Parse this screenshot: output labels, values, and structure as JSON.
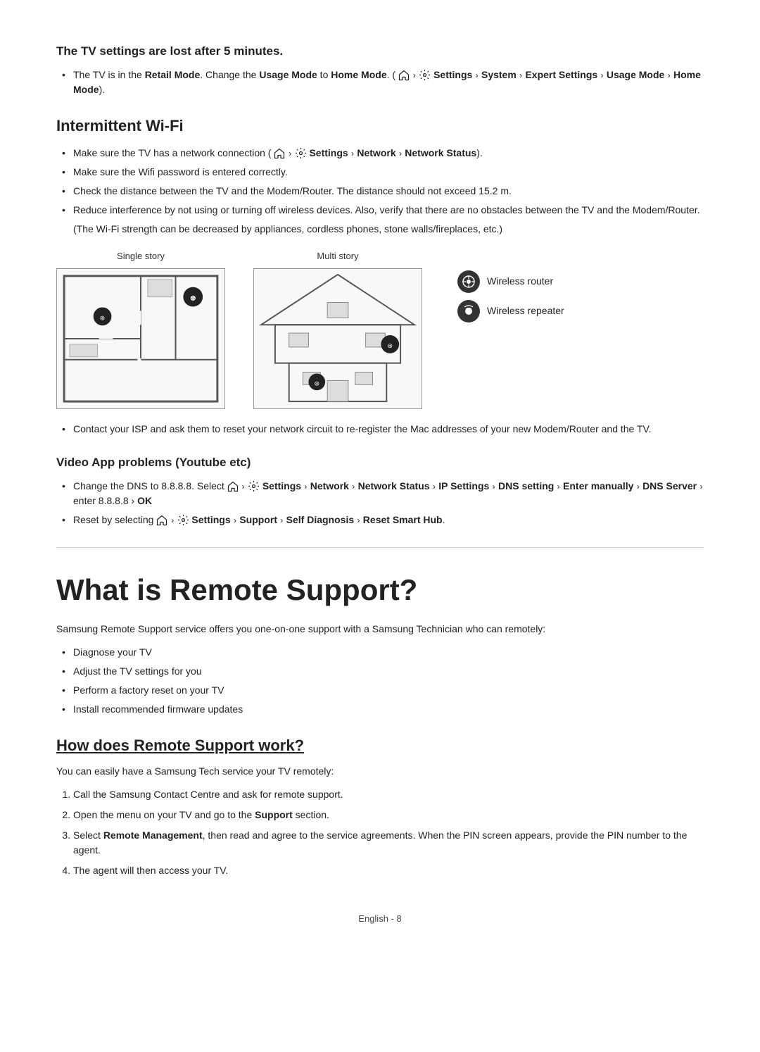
{
  "tv_settings": {
    "title": "The TV settings are lost after 5 minutes.",
    "bullet1_pre": "The TV is in the ",
    "bullet1_retail": "Retail Mode",
    "bullet1_mid": ". Change the ",
    "bullet1_usage": "Usage Mode",
    "bullet1_to": " to ",
    "bullet1_home": "Home Mode",
    "bullet1_path": ". (",
    "bullet1_settings": "Settings",
    "bullet1_system": "System",
    "bullet1_expert": "Expert Settings",
    "bullet1_usagemode": "Usage Mode",
    "bullet1_homemode": "Home Mode",
    "bullet1_end": ")."
  },
  "wifi": {
    "title": "Intermittent Wi-Fi",
    "bullet1_pre": "Make sure the TV has a network connection (",
    "bullet1_settings": "Settings",
    "bullet1_network": "Network",
    "bullet1_status": "Network Status",
    "bullet1_end": ").",
    "bullet2": "Make sure the Wifi password is entered correctly.",
    "bullet3": "Check the distance between the TV and the Modem/Router. The distance should not exceed 15.2 m.",
    "bullet4": "Reduce interference by not using or turning off wireless devices. Also, verify that there are no obstacles between the TV and the Modem/Router.",
    "note": "(The Wi-Fi strength can be decreased by appliances, cordless phones, stone walls/fireplaces, etc.)",
    "label_single": "Single story",
    "label_multi": "Multi story",
    "legend_router": "Wireless router",
    "legend_repeater": "Wireless repeater",
    "bullet5": "Contact your ISP and ask them to reset your network circuit to re-register the Mac addresses of your new Modem/Router and the TV."
  },
  "video_app": {
    "title": "Video App problems (Youtube etc)",
    "bullet1_pre": "Change the DNS to 8.8.8.8. Select ",
    "bullet1_settings": "Settings",
    "bullet1_network": "Network",
    "bullet1_status": "Network Status",
    "bullet1_ip": "IP Settings",
    "bullet1_dns": "DNS setting",
    "bullet1_enter": "Enter manually",
    "bullet1_server": "DNS Server",
    "bullet1_val": "enter 8.8.8.8",
    "bullet1_ok": "OK",
    "bullet2_pre": "Reset by selecting ",
    "bullet2_settings": "Settings",
    "bullet2_support": "Support",
    "bullet2_diag": "Self Diagnosis",
    "bullet2_reset": "Reset Smart Hub"
  },
  "remote_support": {
    "title": "What is Remote Support?",
    "intro": "Samsung Remote Support service offers you one-on-one support with a Samsung Technician who can remotely:",
    "bullets": [
      "Diagnose your TV",
      "Adjust the TV settings for you",
      "Perform a factory reset on your TV",
      "Install recommended firmware updates"
    ]
  },
  "how_works": {
    "title": "How does Remote Support work?",
    "intro": "You can easily have a Samsung Tech service your TV remotely:",
    "steps": [
      "Call the Samsung Contact Centre and ask for remote support.",
      {
        "pre": "Open the menu on your TV and go to the ",
        "bold": "Support",
        "post": " section."
      },
      {
        "pre": "Select ",
        "bold": "Remote Management",
        "post": ", then read and agree to the service agreements. When the PIN screen appears, provide the PIN number to the agent."
      },
      "The agent will then access your TV."
    ]
  },
  "footer": {
    "text": "English - 8"
  }
}
